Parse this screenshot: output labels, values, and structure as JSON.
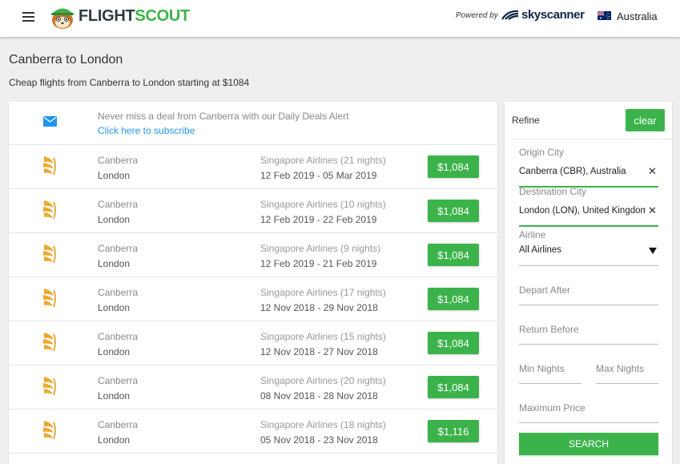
{
  "header": {
    "logo_flight": "FLIGHT",
    "logo_scout": "SCOUT",
    "powered_by": "Powered by",
    "partner": "skyscanner",
    "country": "Australia"
  },
  "page": {
    "title": "Canberra to London",
    "subtitle": "Cheap flights from Canberra to London starting at $1084"
  },
  "alert": {
    "text": "Never miss a deal from Canberra with our Daily Deals Alert",
    "link": "Click here to subscribe"
  },
  "flights": [
    {
      "origin": "Canberra",
      "destination": "London",
      "airline": "Singapore Airlines (21 nights)",
      "dates": "12 Feb 2019 - 05 Mar 2019",
      "price": "$1,084"
    },
    {
      "origin": "Canberra",
      "destination": "London",
      "airline": "Singapore Airlines (10 nights)",
      "dates": "12 Feb 2019 - 22 Feb 2019",
      "price": "$1,084"
    },
    {
      "origin": "Canberra",
      "destination": "London",
      "airline": "Singapore Airlines (9 nights)",
      "dates": "12 Feb 2019 - 21 Feb 2019",
      "price": "$1,084"
    },
    {
      "origin": "Canberra",
      "destination": "London",
      "airline": "Singapore Airlines (17 nights)",
      "dates": "12 Nov 2018 - 29 Nov 2018",
      "price": "$1,084"
    },
    {
      "origin": "Canberra",
      "destination": "London",
      "airline": "Singapore Airlines (15 nights)",
      "dates": "12 Nov 2018 - 27 Nov 2018",
      "price": "$1,084"
    },
    {
      "origin": "Canberra",
      "destination": "London",
      "airline": "Singapore Airlines (20 nights)",
      "dates": "08 Nov 2018 - 28 Nov 2018",
      "price": "$1,084"
    },
    {
      "origin": "Canberra",
      "destination": "London",
      "airline": "Singapore Airlines (18 nights)",
      "dates": "05 Nov 2018 - 23 Nov 2018",
      "price": "$1,116"
    }
  ],
  "refine": {
    "title": "Refine",
    "clear": "clear",
    "origin_label": "Origin City",
    "origin_value": "Canberra (CBR), Australia",
    "destination_label": "Destination City",
    "destination_value": "London (LON), United Kingdom",
    "airline_label": "Airline",
    "airline_value": "All Airlines",
    "depart_after": "Depart After",
    "return_before": "Return Before",
    "min_nights": "Min Nights",
    "max_nights": "Max Nights",
    "max_price": "Maximum Price",
    "search": "SEARCH"
  },
  "colors": {
    "accent": "#3cb34a",
    "link": "#2196f3",
    "airline_logo": "#f0a830"
  },
  "icons": {
    "menu": "hamburger-icon",
    "mail": "mail-icon",
    "airline": "singapore-airlines-logo",
    "clear": "close-icon",
    "dropdown": "caret-down-icon"
  }
}
